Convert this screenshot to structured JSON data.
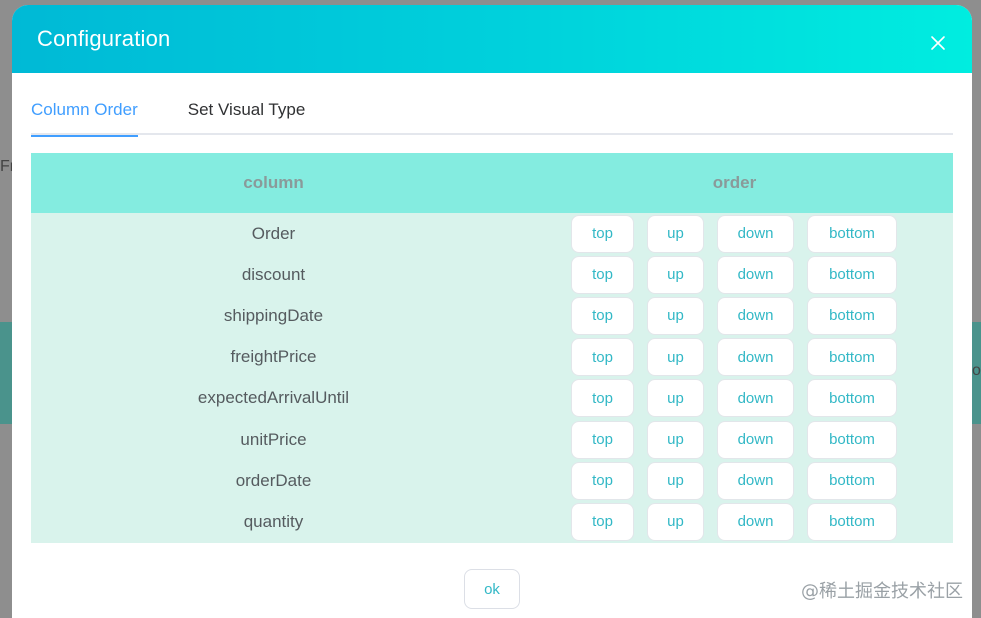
{
  "background": {
    "left_fragment": "Fr",
    "right_fragment": "on"
  },
  "modal": {
    "title": "Configuration",
    "tabs": [
      {
        "label": "Column Order",
        "active": true
      },
      {
        "label": "Set Visual Type",
        "active": false
      }
    ],
    "table": {
      "headers": {
        "column": "column",
        "order": "order"
      },
      "rows": [
        {
          "column": "Order"
        },
        {
          "column": "discount"
        },
        {
          "column": "shippingDate"
        },
        {
          "column": "freightPrice"
        },
        {
          "column": "expectedArrivalUntil"
        },
        {
          "column": "unitPrice"
        },
        {
          "column": "orderDate"
        },
        {
          "column": "quantity"
        }
      ],
      "actions": {
        "top": "top",
        "up": "up",
        "down": "down",
        "bottom": "bottom"
      }
    },
    "ok_label": "ok"
  },
  "watermark": "@稀土掘金技术社区",
  "colors": {
    "header_gradient_start": "#00b9d6",
    "header_gradient_end": "#00ede0",
    "table_header_bg": "#84ece0",
    "table_body_bg": "#d9f3ec",
    "tab_active": "#409eff",
    "button_text": "#32b8c6"
  },
  "icons": {
    "close": "close-icon"
  }
}
